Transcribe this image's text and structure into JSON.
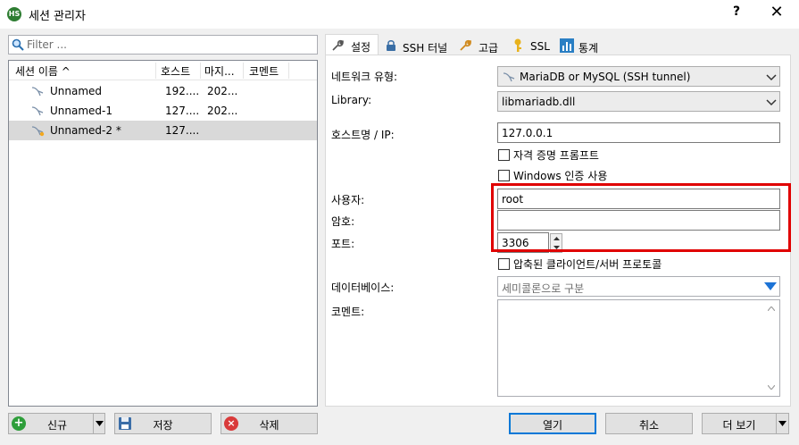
{
  "window": {
    "title": "세션 관리자",
    "icon_text": "HS",
    "help": "?",
    "close": "✕"
  },
  "filter": {
    "placeholder": "Filter ..."
  },
  "session_list": {
    "columns": [
      "세션 이름 ^",
      "호스트",
      "마지...",
      "코멘트"
    ],
    "rows": [
      {
        "name": "Unnamed",
        "host": "192....",
        "last": "202...",
        "comment": "",
        "selected": false
      },
      {
        "name": "Unnamed-1",
        "host": "127....",
        "last": "202...",
        "comment": "",
        "selected": false
      },
      {
        "name": "Unnamed-2 *",
        "host": "127....",
        "last": "",
        "comment": "",
        "selected": true
      }
    ]
  },
  "left_buttons": {
    "new": "신규",
    "save": "저장",
    "delete": "삭제"
  },
  "tabs": [
    {
      "label": "설정",
      "icon": "wrench-icon",
      "active": true
    },
    {
      "label": "SSH 터널",
      "icon": "lock-icon",
      "active": false
    },
    {
      "label": "고급",
      "icon": "wrench-icon",
      "active": false
    },
    {
      "label": "SSL",
      "icon": "key-icon",
      "active": false
    },
    {
      "label": "통계",
      "icon": "bar-chart-icon",
      "active": false
    }
  ],
  "settings": {
    "network_type_label": "네트워크 유형:",
    "network_type_value": "MariaDB or MySQL (SSH tunnel)",
    "library_label": "Library:",
    "library_value": "libmariadb.dll",
    "host_label": "호스트명 / IP:",
    "host_value": "127.0.0.1",
    "credential_prompt_label": "자격 증명 프롬프트",
    "credential_prompt_checked": false,
    "windows_auth_label": "Windows 인증 사용",
    "windows_auth_checked": false,
    "user_label": "사용자:",
    "user_value": "root",
    "password_label": "암호:",
    "password_value": "",
    "port_label": "포트:",
    "port_value": "3306",
    "compressed_label": "압축된 클라이언트/서버 프로토콜",
    "compressed_checked": false,
    "database_label": "데이터베이스:",
    "database_placeholder": "세미콜론으로 구분",
    "comment_label": "코멘트:",
    "comment_value": ""
  },
  "footer_buttons": {
    "open": "열기",
    "cancel": "취소",
    "more": "더 보기"
  },
  "colors": {
    "highlight_box": "#e00000",
    "accent": "#0078d7",
    "new_icon": "#2e9e3a",
    "delete_icon": "#d93a3a"
  }
}
